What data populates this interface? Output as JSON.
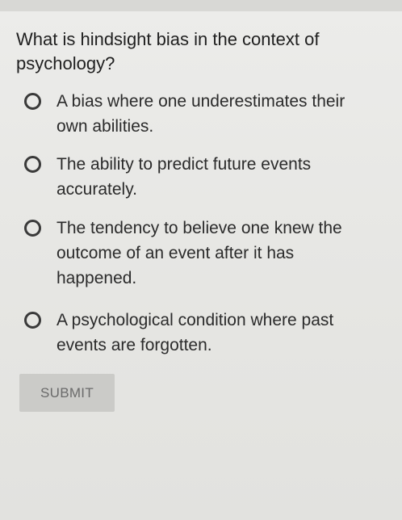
{
  "question": {
    "text": "What is hindsight bias in the context of psychology?"
  },
  "choices": [
    {
      "label": "A bias where one underestimates their own abilities.",
      "selected": false
    },
    {
      "label": "The ability to predict future events accurately.",
      "selected": false
    },
    {
      "label": "The tendency to believe one knew the outcome of an event after it has happened.",
      "selected": false
    },
    {
      "label": "A psychological condition where past events are forgotten.",
      "selected": false
    }
  ],
  "submit": {
    "label": "SUBMIT",
    "enabled": false
  },
  "icons": {
    "radio": "radio-unselected-icon"
  }
}
